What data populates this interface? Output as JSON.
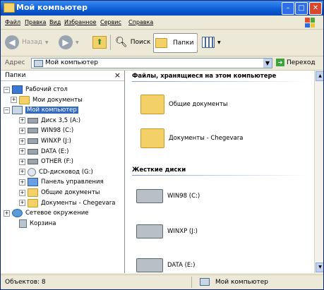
{
  "window": {
    "title": "Мой компьютер"
  },
  "menu": [
    "Файл",
    "Правка",
    "Вид",
    "Избранное",
    "Сервис",
    "Справка"
  ],
  "toolbar": {
    "back_label": "Назад",
    "search_label": "Поиск",
    "folders_label": "Папки"
  },
  "address": {
    "label": "Адрес",
    "value": "Мой компьютер",
    "go_label": "Переход"
  },
  "folders_pane": {
    "title": "Папки",
    "tree": [
      {
        "label": "Рабочий стол",
        "icon": "desktop-icon",
        "expander": "−"
      },
      {
        "label": "Мои документы",
        "icon": "folder-icon",
        "expander": "+"
      },
      {
        "label": "Мой компьютер",
        "icon": "computer-icon",
        "expander": "−",
        "selected": true
      },
      {
        "label": "Диск 3,5 (A:)",
        "icon": "floppy-icon",
        "expander": "+"
      },
      {
        "label": "WIN98 (C:)",
        "icon": "drive-icon",
        "expander": "+"
      },
      {
        "label": "WINXP (J:)",
        "icon": "drive-icon",
        "expander": "+"
      },
      {
        "label": "DATA (E:)",
        "icon": "drive-icon",
        "expander": "+"
      },
      {
        "label": "OTHER (F:)",
        "icon": "drive-icon",
        "expander": "+"
      },
      {
        "label": "CD-дисковод (G:)",
        "icon": "cd-drive-icon",
        "expander": "+"
      },
      {
        "label": "Панель управления",
        "icon": "control-panel-icon",
        "expander": "+"
      },
      {
        "label": "Общие документы",
        "icon": "folder-icon",
        "expander": "+"
      },
      {
        "label": "Документы - Chegevara",
        "icon": "folder-icon",
        "expander": "+"
      },
      {
        "label": "Сетевое окружение",
        "icon": "network-icon",
        "expander": "+"
      },
      {
        "label": "Корзина",
        "icon": "recycle-bin-icon",
        "expander": ""
      }
    ]
  },
  "content": {
    "section_files": "Файлы, хранящиеся на этом компьютере",
    "files": [
      {
        "label": "Общие документы"
      },
      {
        "label": "Документы - Chegevara"
      }
    ],
    "section_drives": "Жесткие диски",
    "drives": [
      {
        "label": "WIN98 (C:)"
      },
      {
        "label": "WINXP (J:)"
      },
      {
        "label": "DATA (E:)"
      }
    ]
  },
  "status": {
    "left": "Объектов: 8",
    "right": "Мой компьютер"
  }
}
